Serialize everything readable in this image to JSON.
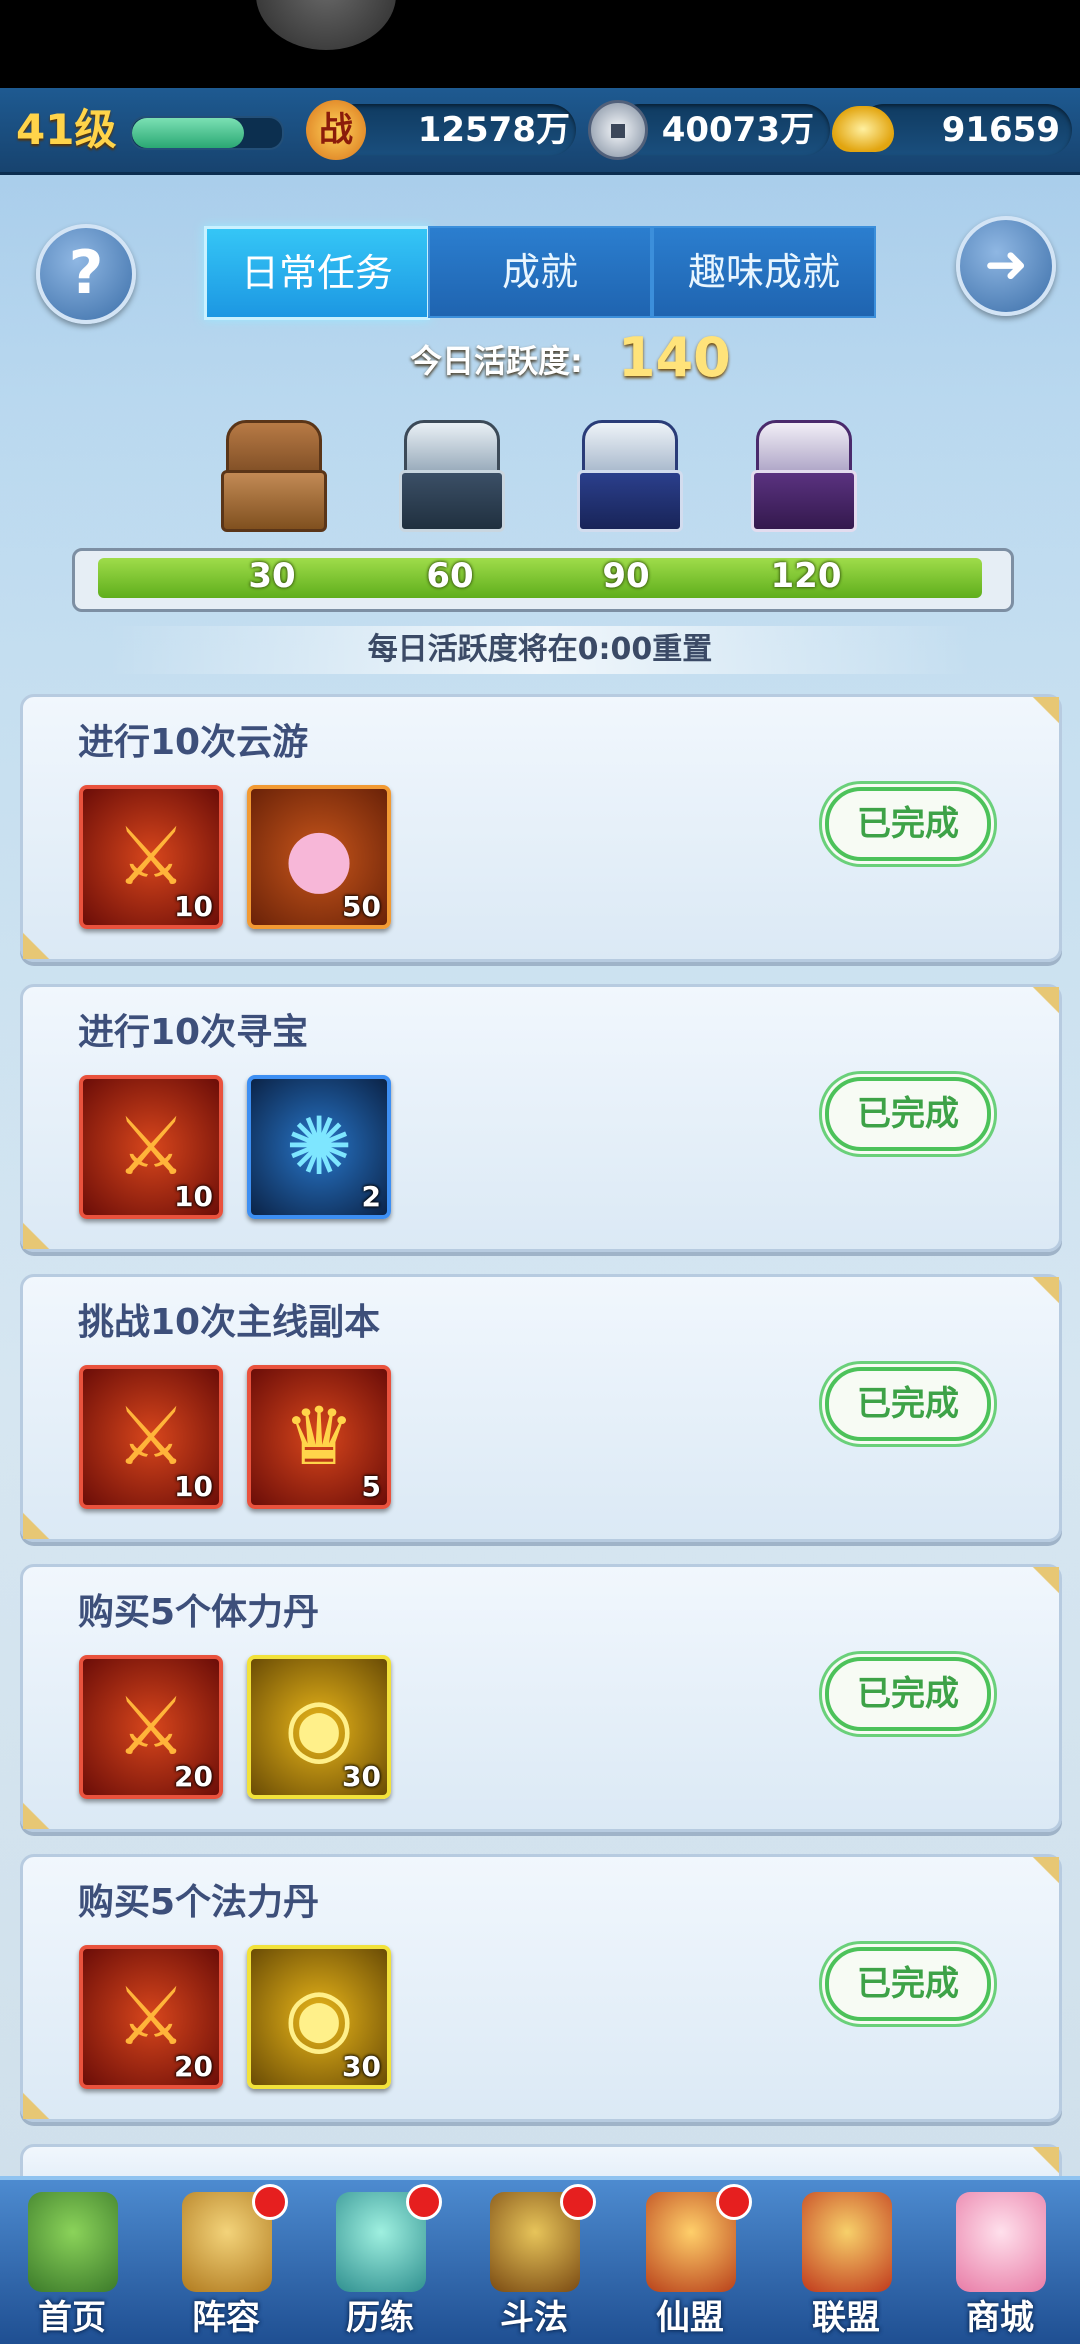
{
  "header": {
    "level": "41级",
    "power_icon": "战",
    "power_value": "12578万",
    "silver_value": "40073万",
    "gold_value": "91659"
  },
  "tabs": [
    {
      "label": "日常任务",
      "active": true
    },
    {
      "label": "成就",
      "active": false
    },
    {
      "label": "趣味成就",
      "active": false
    }
  ],
  "activity": {
    "label": "今日活跃度:",
    "value": "140",
    "milestones": [
      "30",
      "60",
      "90",
      "120"
    ],
    "progress_fraction": 1.0,
    "reset_note": "每日活跃度将在0:00重置"
  },
  "tasks": [
    {
      "title": "进行10次云游",
      "status": "已完成",
      "rewards": [
        {
          "icon": "sword-emblem-icon",
          "count": "10",
          "style": "red"
        },
        {
          "icon": "pink-pearl-icon",
          "count": "50",
          "style": "orange"
        }
      ]
    },
    {
      "title": "进行10次寻宝",
      "status": "已完成",
      "rewards": [
        {
          "icon": "sword-emblem-icon",
          "count": "10",
          "style": "red"
        },
        {
          "icon": "magic-scroll-icon",
          "count": "2",
          "style": "blue"
        }
      ]
    },
    {
      "title": "挑战10次主线副本",
      "status": "已完成",
      "rewards": [
        {
          "icon": "sword-emblem-icon",
          "count": "10",
          "style": "red"
        },
        {
          "icon": "golden-mask-icon",
          "count": "5",
          "style": "red"
        }
      ]
    },
    {
      "title": "购买5个体力丹",
      "status": "已完成",
      "rewards": [
        {
          "icon": "sword-emblem-icon",
          "count": "20",
          "style": "red"
        },
        {
          "icon": "gold-ingot-icon",
          "count": "30",
          "style": "gold"
        }
      ]
    },
    {
      "title": "购买5个法力丹",
      "status": "已完成",
      "rewards": [
        {
          "icon": "sword-emblem-icon",
          "count": "20",
          "style": "red"
        },
        {
          "icon": "gold-ingot-icon",
          "count": "30",
          "style": "gold"
        }
      ]
    }
  ],
  "nav": [
    {
      "label": "首页",
      "badge": false
    },
    {
      "label": "阵容",
      "badge": true
    },
    {
      "label": "历练",
      "badge": true
    },
    {
      "label": "斗法",
      "badge": true
    },
    {
      "label": "仙盟",
      "badge": true
    },
    {
      "label": "联盟",
      "badge": false
    },
    {
      "label": "商城",
      "badge": false
    }
  ],
  "colors": {
    "accent_tab": "#1c97e2",
    "done_green": "#3da247",
    "progress_green": "#7fc635",
    "badge_red": "#e61f1f"
  }
}
